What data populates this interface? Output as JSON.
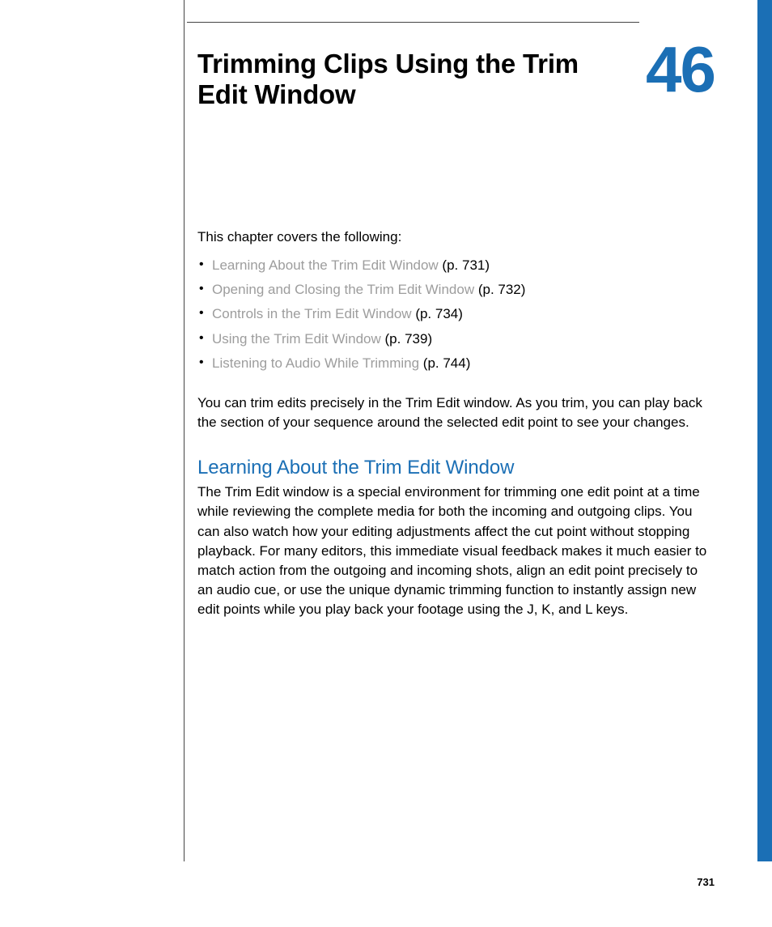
{
  "chapter": {
    "number": "46",
    "title": "Trimming Clips Using the Trim Edit Window"
  },
  "intro_line": "This chapter covers the following:",
  "toc": [
    {
      "label": "Learning About the Trim Edit Window",
      "page_ref": " (p. 731)"
    },
    {
      "label": "Opening and Closing the Trim Edit Window",
      "page_ref": " (p. 732)"
    },
    {
      "label": "Controls in the Trim Edit Window",
      "page_ref": " (p. 734)"
    },
    {
      "label": "Using the Trim Edit Window",
      "page_ref": " (p. 739)"
    },
    {
      "label": "Listening to Audio While Trimming",
      "page_ref": " (p. 744)"
    }
  ],
  "lead_paragraph": "You can trim edits precisely in the Trim Edit window. As you trim, you can play back the section of your sequence around the selected edit point to see your changes.",
  "section": {
    "heading": "Learning About the Trim Edit Window",
    "body": "The Trim Edit window is a special environment for trimming one edit point at a time while reviewing the complete media for both the incoming and outgoing clips. You can also watch how your editing adjustments affect the cut point without stopping playback. For many editors, this immediate visual feedback makes it much easier to match action from the outgoing and incoming shots, align an edit point precisely to an audio cue, or use the unique dynamic trimming function to instantly assign new edit points while you play back your footage using the J, K, and L keys."
  },
  "page_number": "731"
}
